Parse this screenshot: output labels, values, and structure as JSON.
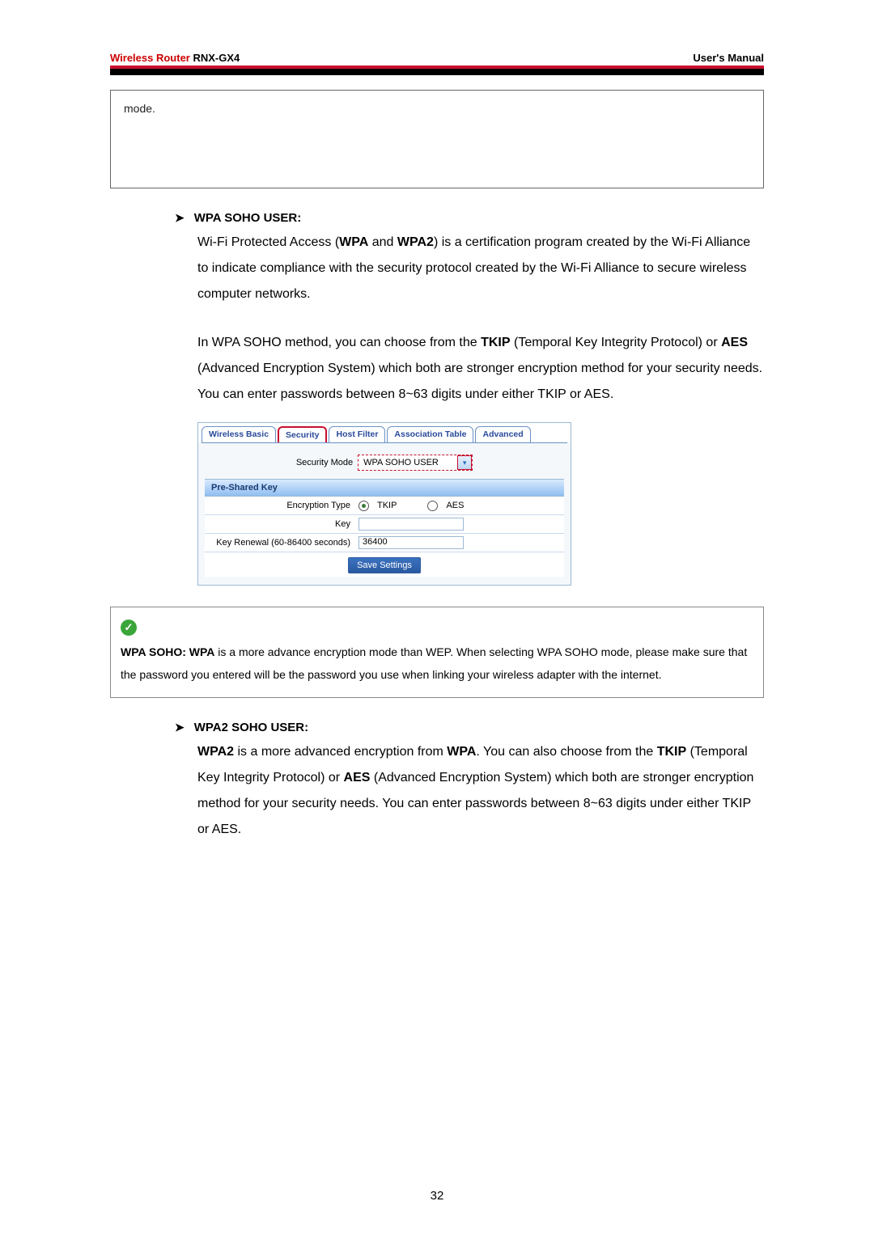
{
  "header": {
    "brand": "Wireless Router",
    "model": "RNX-GX4",
    "right": "User's Manual"
  },
  "box_top_text": "mode.",
  "sec1": {
    "title": "WPA SOHO USER:",
    "p1_pre": "Wi-Fi Protected Access (",
    "p1_b1": "WPA",
    "p1_mid1": " and ",
    "p1_b2": "WPA2",
    "p1_post": ") is a certification program created by the Wi-Fi Alliance to indicate compliance with the security protocol created by the Wi-Fi Alliance to secure wireless computer networks.",
    "p2_pre": "In WPA SOHO method, you can choose from the ",
    "p2_b1": "TKIP",
    "p2_mid1": " (Temporal Key Integrity Protocol) or ",
    "p2_b2": "AES",
    "p2_post": " (Advanced Encryption System) which both are stronger encryption method for your security needs. You can enter passwords between 8~63 digits under either TKIP or AES."
  },
  "shot": {
    "tabs": {
      "t0": "Wireless Basic",
      "t1": "Security",
      "t2": "Host Filter",
      "t3": "Association Table",
      "t4": "Advanced"
    },
    "mode_label": "Security Mode",
    "mode_value": "WPA SOHO USER",
    "psk_header": "Pre-Shared Key",
    "row_enc_label": "Encryption Type",
    "row_enc_opt1": "TKIP",
    "row_enc_opt2": "AES",
    "row_key_label": "Key",
    "row_key_value": "",
    "row_renew_label": "Key Renewal (60-86400 seconds)",
    "row_renew_value": "36400",
    "save": "Save Settings"
  },
  "tip": {
    "lead_b": "WPA SOHO: WPA",
    "text": " is a more advance encryption mode than WEP. When selecting WPA SOHO mode, please make sure that the password you entered will be the password you use when linking your wireless adapter with the internet."
  },
  "sec2": {
    "title": "WPA2 SOHO USER:",
    "pre1": "",
    "b1": "WPA2",
    "mid1": " is a more advanced encryption from ",
    "b2": "WPA",
    "mid2": ". You can also choose from the ",
    "b3": "TKIP",
    "mid3": " (Temporal Key Integrity Protocol) or ",
    "b4": "AES",
    "post": " (Advanced Encryption System) which both are stronger encryption method for your security needs. You can enter passwords between 8~63 digits under either TKIP or AES."
  },
  "page_number": "32"
}
